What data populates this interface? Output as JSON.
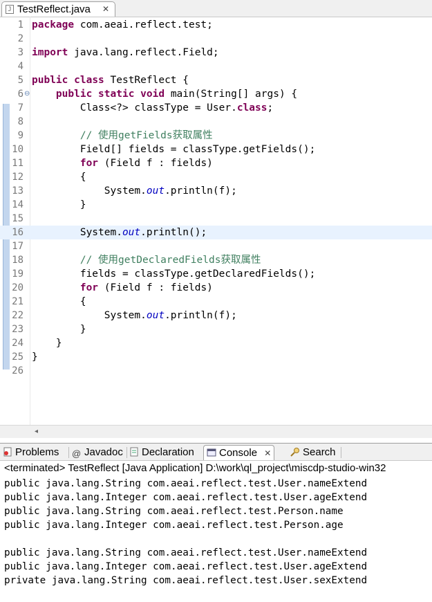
{
  "editor": {
    "tab": {
      "title": "TestReflect.java",
      "close_glyph": "✕",
      "icon": "java-file-icon"
    },
    "lines": [
      {
        "no": "1",
        "text": "package com.aeai.reflect.test;"
      },
      {
        "no": "2",
        "text": ""
      },
      {
        "no": "3",
        "text": "import java.lang.reflect.Field;"
      },
      {
        "no": "4",
        "text": ""
      },
      {
        "no": "5",
        "text": "public class TestReflect {"
      },
      {
        "no": "6",
        "text": "    public static void main(String[] args) {"
      },
      {
        "no": "7",
        "text": "        Class<?> classType = User.class;"
      },
      {
        "no": "8",
        "text": ""
      },
      {
        "no": "9",
        "text": "        // 使用getFields获取属性"
      },
      {
        "no": "10",
        "text": "        Field[] fields = classType.getFields();"
      },
      {
        "no": "11",
        "text": "        for (Field f : fields)"
      },
      {
        "no": "12",
        "text": "        {"
      },
      {
        "no": "13",
        "text": "            System.out.println(f);"
      },
      {
        "no": "14",
        "text": "        }"
      },
      {
        "no": "15",
        "text": ""
      },
      {
        "no": "16",
        "text": "        System.out.println();"
      },
      {
        "no": "17",
        "text": ""
      },
      {
        "no": "18",
        "text": "        // 使用getDeclaredFields获取属性"
      },
      {
        "no": "19",
        "text": "        fields = classType.getDeclaredFields();"
      },
      {
        "no": "20",
        "text": "        for (Field f : fields)"
      },
      {
        "no": "21",
        "text": "        {"
      },
      {
        "no": "22",
        "text": "            System.out.println(f);"
      },
      {
        "no": "23",
        "text": "        }"
      },
      {
        "no": "24",
        "text": "    }"
      },
      {
        "no": "25",
        "text": "}"
      },
      {
        "no": "26",
        "text": ""
      }
    ],
    "current_line": "16",
    "folding_line": "6",
    "colors": {
      "keyword": "#7f0055",
      "comment": "#3f7f5f",
      "static_field": "#0000c0",
      "current_line_bg": "#e8f2fe"
    }
  },
  "views": {
    "tabs": [
      {
        "label": "Problems",
        "icon": "problems-icon"
      },
      {
        "label": "Javadoc",
        "icon": "javadoc-icon"
      },
      {
        "label": "Declaration",
        "icon": "declaration-icon"
      },
      {
        "label": "Console",
        "icon": "console-icon",
        "active": true,
        "close_glyph": "✕"
      },
      {
        "label": "Search",
        "icon": "search-icon"
      }
    ]
  },
  "console": {
    "status": "<terminated> TestReflect [Java Application] D:\\work\\ql_project\\miscdp-studio-win32",
    "output": [
      "public java.lang.String com.aeai.reflect.test.User.nameExtend",
      "public java.lang.Integer com.aeai.reflect.test.User.ageExtend",
      "public java.lang.String com.aeai.reflect.test.Person.name",
      "public java.lang.Integer com.aeai.reflect.test.Person.age",
      "",
      "public java.lang.String com.aeai.reflect.test.User.nameExtend",
      "public java.lang.Integer com.aeai.reflect.test.User.ageExtend",
      "private java.lang.String com.aeai.reflect.test.User.sexExtend"
    ]
  }
}
